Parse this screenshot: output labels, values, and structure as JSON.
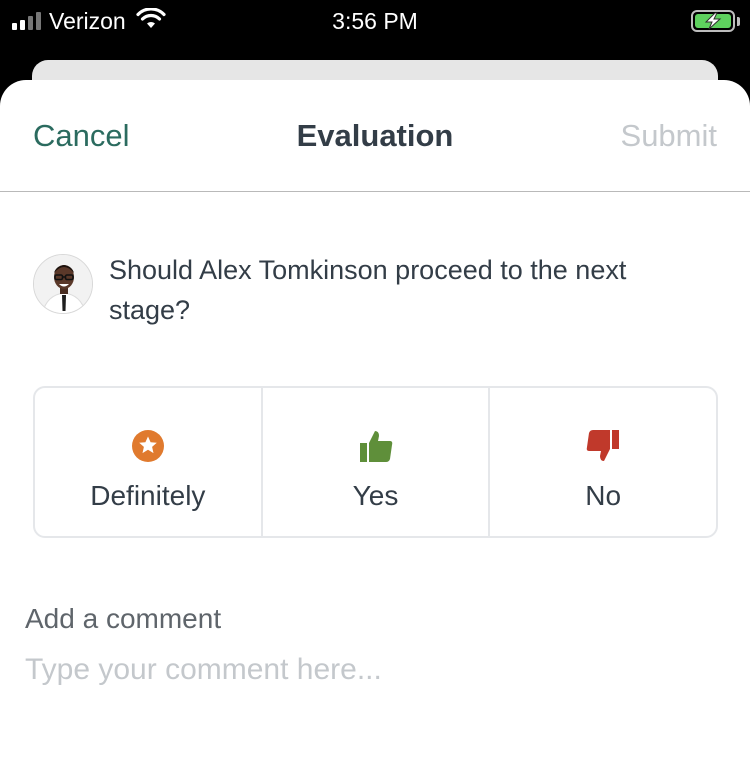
{
  "status_bar": {
    "carrier": "Verizon",
    "time": "3:56 PM",
    "signal_icon": "cellular-signal-icon",
    "wifi_icon": "wifi-icon",
    "battery_icon": "battery-charging-icon"
  },
  "nav": {
    "cancel_label": "Cancel",
    "title": "Evaluation",
    "submit_label": "Submit"
  },
  "question": {
    "text": "Should Alex Tomkinson proceed to the next stage?",
    "avatar_icon": "candidate-avatar"
  },
  "choices": [
    {
      "label": "Definitely",
      "icon": "star-icon",
      "color": "#e07a2e"
    },
    {
      "label": "Yes",
      "icon": "thumbs-up-icon",
      "color": "#5f8f3a"
    },
    {
      "label": "No",
      "icon": "thumbs-down-icon",
      "color": "#c0392b"
    }
  ],
  "comment": {
    "label": "Add a comment",
    "placeholder": "Type your comment here...",
    "value": ""
  },
  "colors": {
    "accent": "#2b6b5f",
    "text": "#333d47",
    "disabled": "#c4c8cc"
  }
}
